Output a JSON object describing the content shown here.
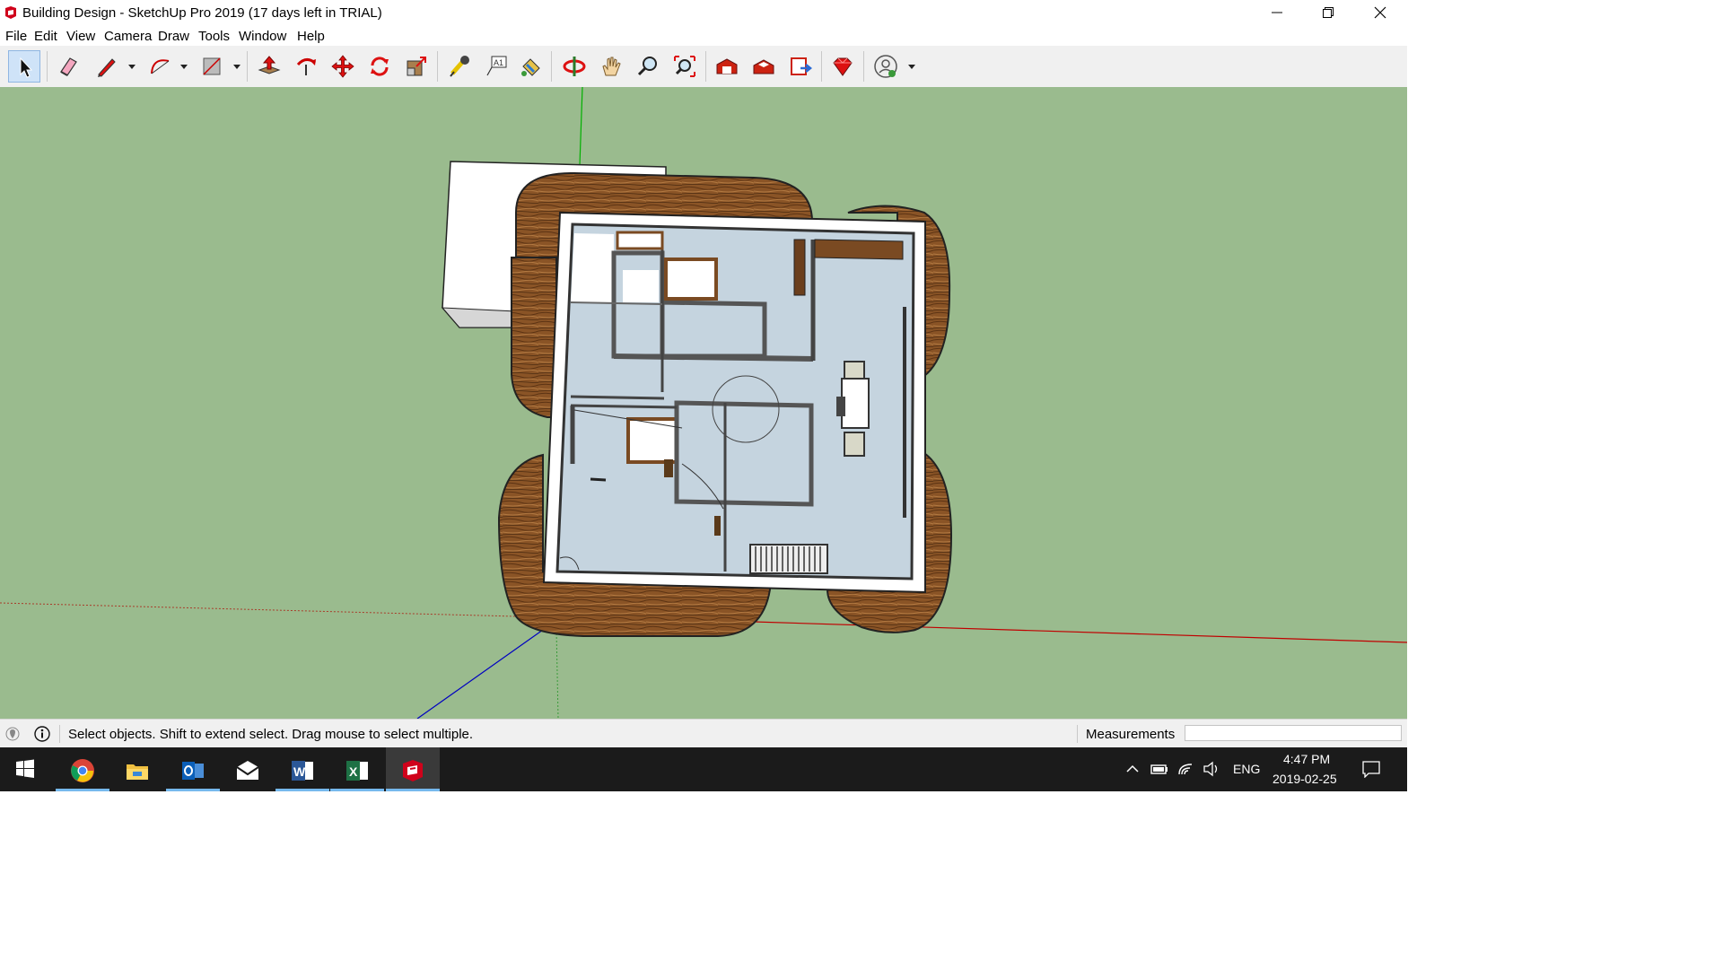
{
  "window": {
    "title": "Building Design - SketchUp Pro 2019 (17 days left in TRIAL)",
    "controls": [
      "minimize",
      "restore",
      "close"
    ]
  },
  "menu": {
    "items": [
      "File",
      "Edit",
      "View",
      "Camera",
      "Draw",
      "Tools",
      "Window",
      "Help"
    ]
  },
  "toolbar": {
    "tools": [
      {
        "name": "select-tool",
        "icon": "arrow-cursor-icon",
        "active": true
      },
      {
        "name": "eraser-tool",
        "icon": "eraser-icon"
      },
      {
        "name": "pencil-tool",
        "icon": "pencil-icon"
      },
      {
        "name": "arc-tool",
        "icon": "arc-icon"
      },
      {
        "name": "rectangle-tool",
        "icon": "rectangle-icon"
      },
      {
        "name": "push-pull-tool",
        "icon": "push-pull-icon"
      },
      {
        "name": "follow-me-tool",
        "icon": "follow-me-icon"
      },
      {
        "name": "move-tool",
        "icon": "move-arrows-icon"
      },
      {
        "name": "rotate-tool",
        "icon": "rotate-icon"
      },
      {
        "name": "scale-tool",
        "icon": "scale-icon"
      },
      {
        "name": "tape-measure-tool",
        "icon": "tape-measure-icon"
      },
      {
        "name": "text-tool",
        "icon": "text-label-icon"
      },
      {
        "name": "paint-bucket-tool",
        "icon": "paint-bucket-icon"
      },
      {
        "name": "orbit-tool",
        "icon": "orbit-icon"
      },
      {
        "name": "pan-tool",
        "icon": "hand-icon"
      },
      {
        "name": "zoom-tool",
        "icon": "magnifier-icon"
      },
      {
        "name": "zoom-extents-tool",
        "icon": "zoom-extents-icon"
      },
      {
        "name": "3d-warehouse",
        "icon": "warehouse-icon"
      },
      {
        "name": "extension-warehouse",
        "icon": "extension-warehouse-icon"
      },
      {
        "name": "send-to-layout",
        "icon": "layout-icon"
      },
      {
        "name": "extension-manager",
        "icon": "ruby-gem-icon"
      },
      {
        "name": "account",
        "icon": "user-account-icon"
      }
    ]
  },
  "status": {
    "hint": "Select objects. Shift to extend select. Drag mouse to select multiple.",
    "measurements_label": "Measurements",
    "measurements_value": ""
  },
  "taskbar": {
    "apps": [
      {
        "name": "start",
        "icon": "windows-logo-icon"
      },
      {
        "name": "chrome",
        "icon": "chrome-icon"
      },
      {
        "name": "file-explorer",
        "icon": "folder-icon"
      },
      {
        "name": "outlook",
        "icon": "outlook-icon"
      },
      {
        "name": "mail",
        "icon": "mail-icon"
      },
      {
        "name": "word",
        "icon": "word-icon"
      },
      {
        "name": "excel",
        "icon": "excel-icon"
      },
      {
        "name": "sketchup",
        "icon": "sketchup-icon",
        "active": true
      }
    ],
    "tray": {
      "language": "ENG",
      "time": "4:47 PM",
      "date": "2019-02-25"
    }
  },
  "colors": {
    "viewport_bg": "#9abb8e",
    "wood": "#7a4a22",
    "floor": "#c8d6e0",
    "wall": "#ffffff",
    "taskbar": "#1b1b1b",
    "axis_red": "#c00000",
    "axis_green": "#00b000",
    "axis_blue": "#0000c0"
  }
}
